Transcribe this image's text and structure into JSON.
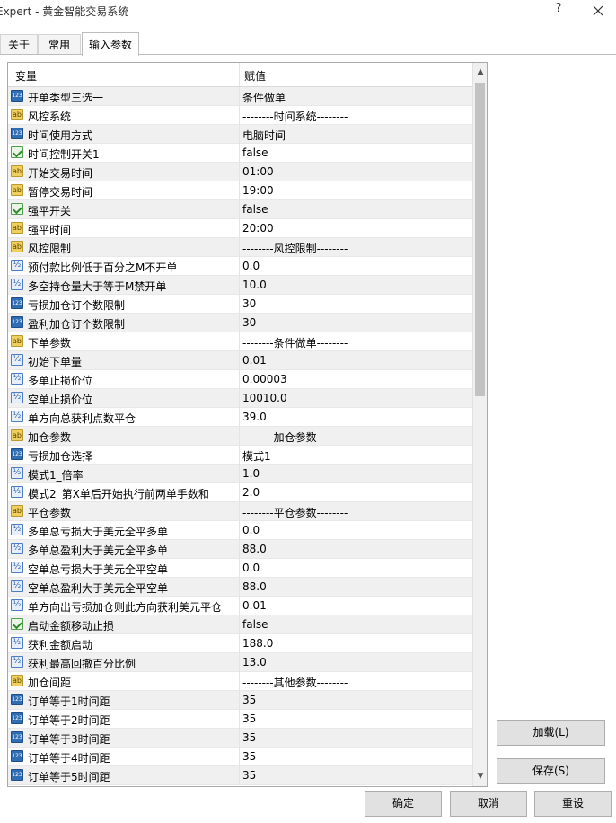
{
  "window": {
    "title": "Expert - 黄金智能交易系统",
    "help_glyph": "?",
    "close_icon": "close-icon"
  },
  "tabs": [
    {
      "label": "关于"
    },
    {
      "label": "常用"
    },
    {
      "label": "输入参数",
      "active": true
    }
  ],
  "grid": {
    "headers": {
      "variable": "变量",
      "value": "赋值"
    },
    "rows": [
      {
        "type": "int",
        "name": "开单类型三选一",
        "value": "条件做单"
      },
      {
        "type": "string",
        "name": "风控系统",
        "value": "--------时间系统--------"
      },
      {
        "type": "int",
        "name": "时间使用方式",
        "value": "电脑时间"
      },
      {
        "type": "bool",
        "name": "时间控制开关1",
        "value": "false"
      },
      {
        "type": "string",
        "name": "开始交易时间",
        "value": "01:00"
      },
      {
        "type": "string",
        "name": "暂停交易时间",
        "value": "19:00"
      },
      {
        "type": "bool",
        "name": "强平开关",
        "value": "false"
      },
      {
        "type": "string",
        "name": "强平时间",
        "value": "20:00"
      },
      {
        "type": "string",
        "name": "风控限制",
        "value": "--------风控限制--------"
      },
      {
        "type": "double",
        "name": "预付款比例低于百分之M不开单",
        "value": "0.0"
      },
      {
        "type": "double",
        "name": "多空持仓量大于等于M禁开单",
        "value": "10.0"
      },
      {
        "type": "int",
        "name": "亏损加仓订个数限制",
        "value": "30"
      },
      {
        "type": "int",
        "name": "盈利加仓订个数限制",
        "value": "30"
      },
      {
        "type": "string",
        "name": "下单参数",
        "value": "--------条件做单--------"
      },
      {
        "type": "double",
        "name": "初始下单量",
        "value": "0.01"
      },
      {
        "type": "double",
        "name": "多单止损价位",
        "value": "0.00003"
      },
      {
        "type": "double",
        "name": "空单止损价位",
        "value": "10010.0"
      },
      {
        "type": "double",
        "name": "单方向总获利点数平仓",
        "value": "39.0"
      },
      {
        "type": "string",
        "name": "加仓参数",
        "value": "--------加仓参数--------"
      },
      {
        "type": "int",
        "name": "亏损加仓选择",
        "value": "模式1"
      },
      {
        "type": "double",
        "name": "模式1_倍率",
        "value": "1.0"
      },
      {
        "type": "double",
        "name": "模式2_第X单后开始执行前两单手数和",
        "value": "2.0"
      },
      {
        "type": "string",
        "name": "平仓参数",
        "value": "--------平仓参数--------"
      },
      {
        "type": "double",
        "name": "多单总亏损大于美元全平多单",
        "value": "0.0"
      },
      {
        "type": "double",
        "name": "多单总盈利大于美元全平多单",
        "value": "88.0"
      },
      {
        "type": "double",
        "name": "空单总亏损大于美元全平空单",
        "value": "0.0"
      },
      {
        "type": "double",
        "name": "空单总盈利大于美元全平空单",
        "value": "88.0"
      },
      {
        "type": "double",
        "name": "单方向出亏损加仓则此方向获利美元平仓",
        "value": "0.01"
      },
      {
        "type": "bool",
        "name": "启动金额移动止损",
        "value": "false"
      },
      {
        "type": "double",
        "name": "获利金额启动",
        "value": "188.0"
      },
      {
        "type": "double",
        "name": "获利最高回撤百分比例",
        "value": "13.0"
      },
      {
        "type": "string",
        "name": "加仓间距",
        "value": "--------其他参数--------"
      },
      {
        "type": "int",
        "name": "订单等于1时间距",
        "value": "35"
      },
      {
        "type": "int",
        "name": "订单等于2时间距",
        "value": "35"
      },
      {
        "type": "int",
        "name": "订单等于3时间距",
        "value": "35"
      },
      {
        "type": "int",
        "name": "订单等于4时间距",
        "value": "35"
      },
      {
        "type": "int",
        "name": "订单等于5时间距",
        "value": "35"
      }
    ]
  },
  "side_buttons": {
    "load": "加载(L)",
    "save": "保存(S)"
  },
  "footer_buttons": {
    "ok": "确定",
    "cancel": "取消",
    "reset": "重设"
  }
}
